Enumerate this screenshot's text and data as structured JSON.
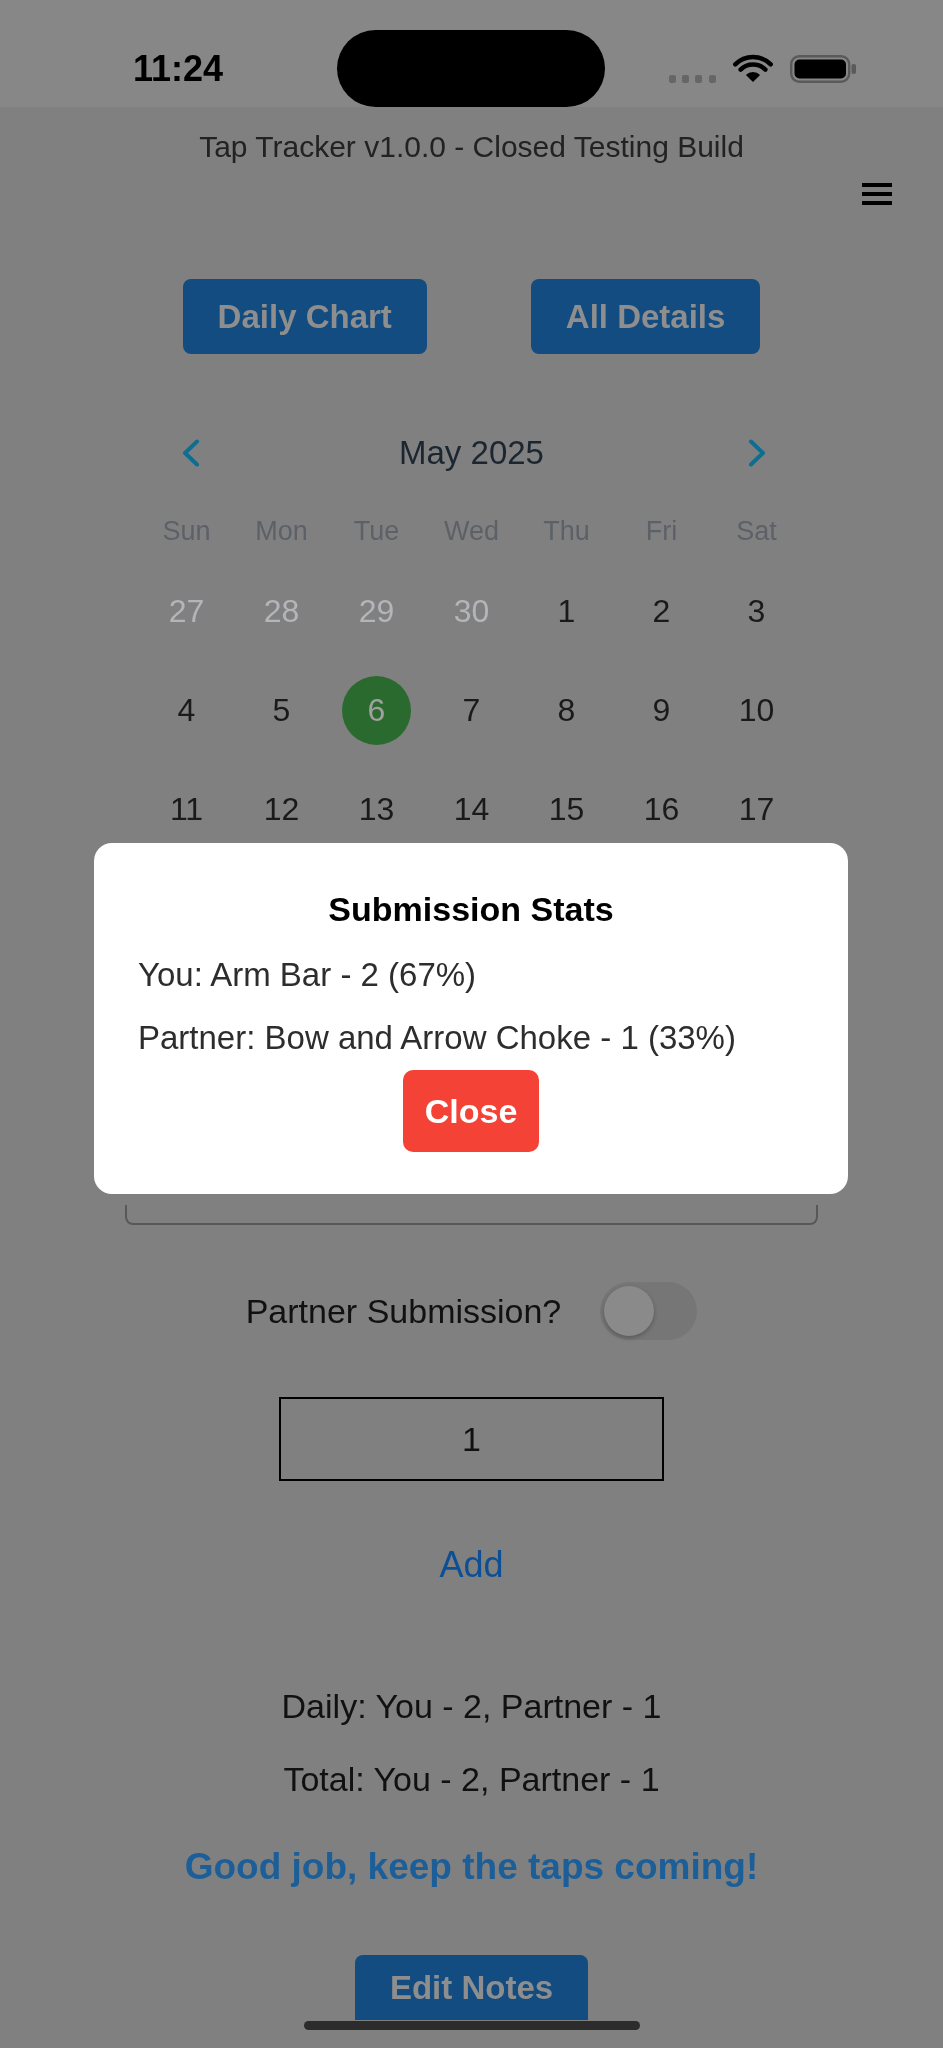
{
  "status_bar": {
    "time": "11:24"
  },
  "header": {
    "title": "Tap Tracker v1.0.0 - Closed Testing Build"
  },
  "top_buttons": [
    {
      "label": "Daily Chart"
    },
    {
      "label": "All Details"
    }
  ],
  "calendar": {
    "month_label": "May 2025",
    "weekdays": [
      "Sun",
      "Mon",
      "Tue",
      "Wed",
      "Thu",
      "Fri",
      "Sat"
    ],
    "weeks": [
      [
        {
          "day": "27",
          "outside_month": true,
          "selected": false
        },
        {
          "day": "28",
          "outside_month": true,
          "selected": false
        },
        {
          "day": "29",
          "outside_month": true,
          "selected": false
        },
        {
          "day": "30",
          "outside_month": true,
          "selected": false
        },
        {
          "day": "1",
          "outside_month": false,
          "selected": false
        },
        {
          "day": "2",
          "outside_month": false,
          "selected": false
        },
        {
          "day": "3",
          "outside_month": false,
          "selected": false
        }
      ],
      [
        {
          "day": "4",
          "outside_month": false,
          "selected": false
        },
        {
          "day": "5",
          "outside_month": false,
          "selected": false
        },
        {
          "day": "6",
          "outside_month": false,
          "selected": true
        },
        {
          "day": "7",
          "outside_month": false,
          "selected": false
        },
        {
          "day": "8",
          "outside_month": false,
          "selected": false
        },
        {
          "day": "9",
          "outside_month": false,
          "selected": false
        },
        {
          "day": "10",
          "outside_month": false,
          "selected": false
        }
      ],
      [
        {
          "day": "11",
          "outside_month": false,
          "selected": false
        },
        {
          "day": "12",
          "outside_month": false,
          "selected": false
        },
        {
          "day": "13",
          "outside_month": false,
          "selected": false
        },
        {
          "day": "14",
          "outside_month": false,
          "selected": false
        },
        {
          "day": "15",
          "outside_month": false,
          "selected": false
        },
        {
          "day": "16",
          "outside_month": false,
          "selected": false
        },
        {
          "day": "17",
          "outside_month": false,
          "selected": false
        }
      ]
    ]
  },
  "entry_form": {
    "partner_submission": {
      "label": "Partner Submission?",
      "on": false
    },
    "count_field": {
      "value": "1"
    },
    "add_button": {
      "label": "Add"
    }
  },
  "totals": [
    "Daily: You - 2, Partner - 1",
    "Total: You - 2, Partner - 1"
  ],
  "encouragement": "Good job, keep the taps coming!",
  "edit_notes_button": {
    "label": "Edit Notes"
  },
  "stats_modal": {
    "title": "Submission Stats",
    "lines": [
      "You: Arm Bar - 2 (67%)",
      "Partner: Bow and Arrow Choke - 1 (33%)"
    ],
    "close_button": {
      "label": "Close"
    }
  }
}
